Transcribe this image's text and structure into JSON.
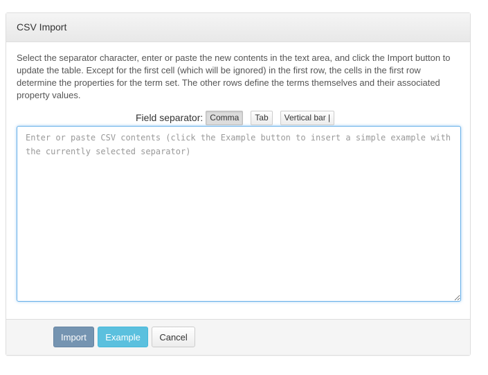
{
  "dialog": {
    "title": "CSV Import",
    "description": "Select the separator character, enter or paste the new contents in the text area, and click the Import button to update the table. Except for the first cell (which will be ignored) in the first row, the cells in the first row determine the properties for the term set. The other rows define the terms themselves and their associated property values."
  },
  "separator": {
    "label": "Field separator:",
    "options": [
      "Comma",
      "Tab",
      "Vertical bar |"
    ],
    "selected": "Comma"
  },
  "textarea": {
    "value": "",
    "placeholder": "Enter or paste CSV contents (click the Example button to insert a simple example with the currently selected separator)"
  },
  "footer": {
    "import_label": "Import",
    "example_label": "Example",
    "cancel_label": "Cancel"
  },
  "colors": {
    "focus_border": "#66afe9",
    "import_button": "#6f8fae",
    "example_button": "#5bc0de"
  }
}
